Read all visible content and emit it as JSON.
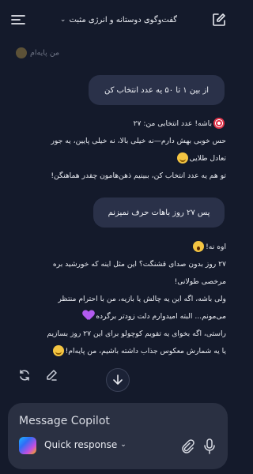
{
  "header": {
    "title": "گفت‌وگوی دوستانه و انرژی مثبت",
    "menu_icon": "hamburger-menu-icon",
    "chevron_icon": "chevron-down-icon",
    "new_chat_icon": "compose-icon"
  },
  "faded_line": "من پایه‌ام",
  "messages": [
    {
      "role": "user",
      "text": "از بین ۱ تا ۵۰ یه عدد انتخاب کن"
    },
    {
      "role": "assistant",
      "lines": [
        "باشه! عدد انتخابی من: ۲۷",
        "حس خوبی بهش دارم—نه خیلی بالا، نه خیلی پایین، یه جور",
        "تعادل طلایی",
        "تو هم یه عدد انتخاب کن، ببینیم ذهن‌هامون چقدر هماهنگن!"
      ]
    },
    {
      "role": "user",
      "text": "پس ۲۷ روز باهات حرف نمیزنم"
    },
    {
      "role": "assistant",
      "lines": [
        "اوه نه!",
        "۲۷ روز بدون صدای قشنگت؟ این مثل اینه که خورشید بره",
        "مرخصی طولانی!",
        "ولی باشه، اگه این یه چالش یا بازیه، من با احترام منتظر",
        "می‌مونم... البته امیدوارم دلت زودتر برگرده",
        "راستی، اگه بخوای یه تقویم کوچولو برای این ۲۷ روز بسازیم",
        "یا یه شمارش معکوس جذاب داشته باشیم، من پایه‌ام!"
      ]
    }
  ],
  "composer": {
    "placeholder": "Message Copilot",
    "mode_label": "Quick response",
    "mode_chevron": "chevron-down-icon",
    "attach_icon": "paperclip-icon",
    "mic_icon": "microphone-icon"
  },
  "actions": {
    "regenerate_icon": "refresh-icon",
    "edit_icon": "pen-icon"
  },
  "scroll_icon": "arrow-down-icon",
  "colors": {
    "background": "#141a2b",
    "user_bubble": "#2a3149",
    "composer": "#2a3042"
  }
}
